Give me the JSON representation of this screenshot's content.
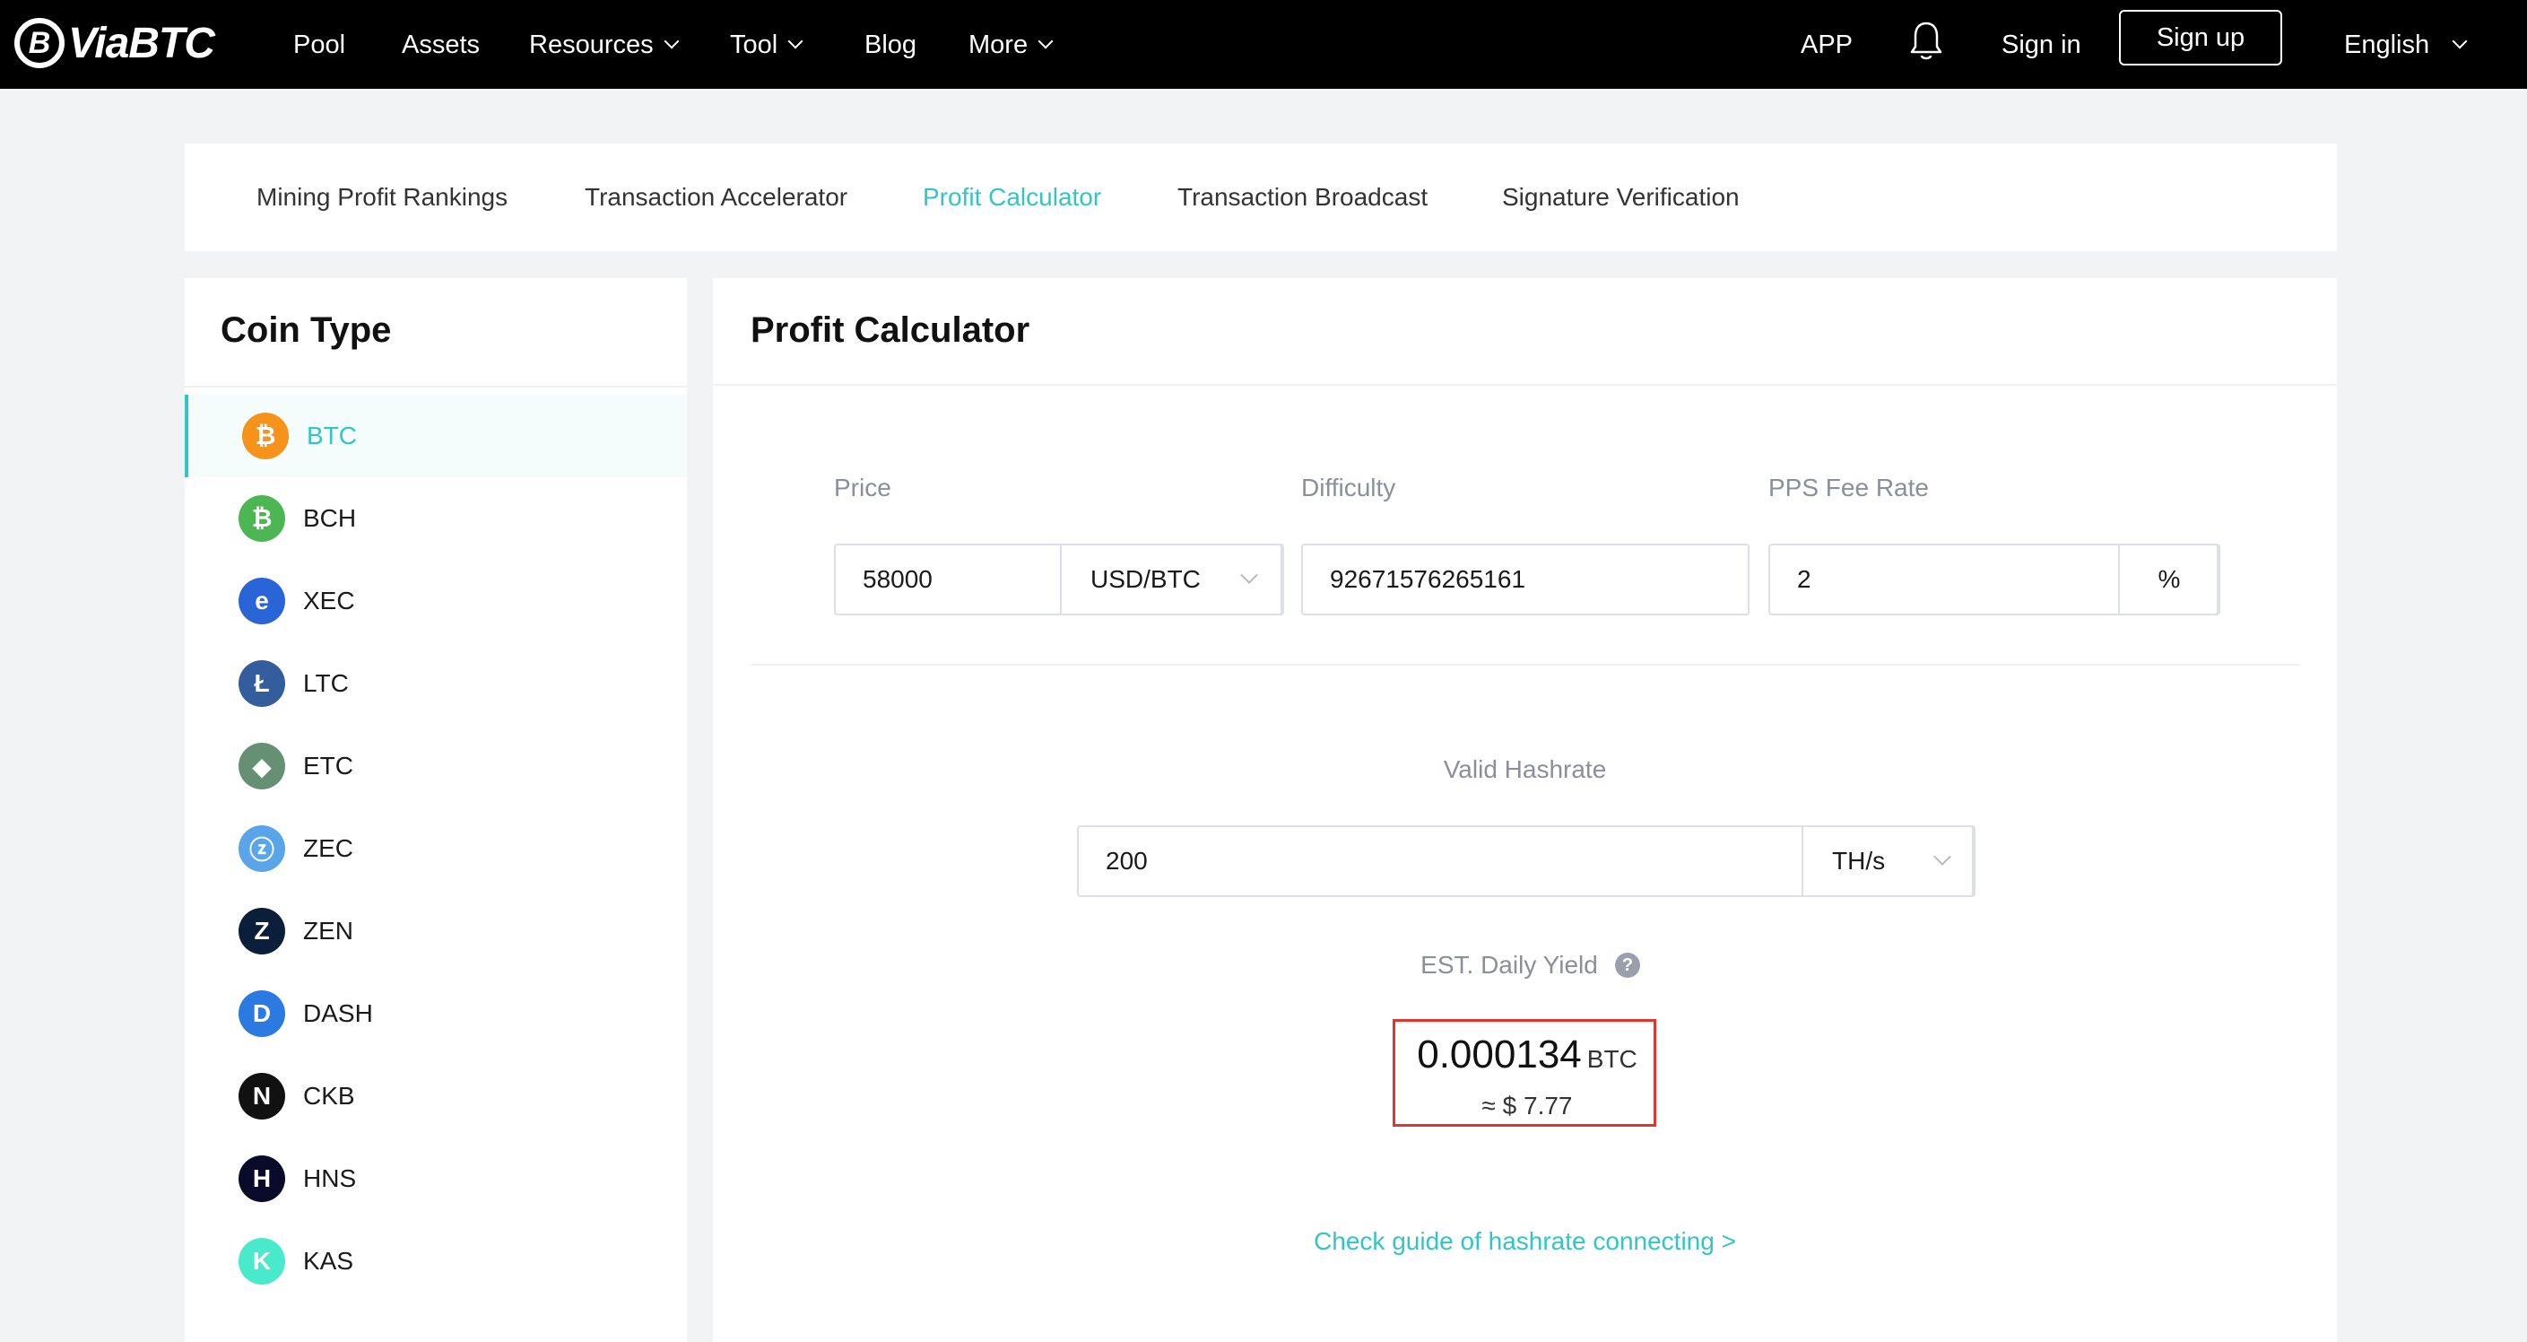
{
  "brand": {
    "name": "ViaBTC",
    "logo_mark": "B"
  },
  "nav": {
    "items": [
      {
        "label": "Pool",
        "has_dropdown": false
      },
      {
        "label": "Assets",
        "has_dropdown": false
      },
      {
        "label": "Resources",
        "has_dropdown": true
      },
      {
        "label": "Tool",
        "has_dropdown": true
      },
      {
        "label": "Blog",
        "has_dropdown": false
      },
      {
        "label": "More",
        "has_dropdown": true
      }
    ],
    "app_label": "APP",
    "bell_icon": "bell-icon",
    "signin_label": "Sign in",
    "signup_label": "Sign up",
    "language_label": "English"
  },
  "tool_tabs": [
    {
      "label": "Mining Profit Rankings",
      "active": false
    },
    {
      "label": "Transaction Accelerator",
      "active": false
    },
    {
      "label": "Profit Calculator",
      "active": true
    },
    {
      "label": "Transaction Broadcast",
      "active": false
    },
    {
      "label": "Signature Verification",
      "active": false
    }
  ],
  "sidebar": {
    "title": "Coin Type",
    "coins": [
      {
        "name": "BTC",
        "icon": "btc-icon",
        "glyph": "₿",
        "color": "#f7931a",
        "active": true
      },
      {
        "name": "BCH",
        "icon": "bch-icon",
        "glyph": "₿",
        "color": "#4cb652",
        "active": false
      },
      {
        "name": "XEC",
        "icon": "xec-icon",
        "glyph": "e",
        "color": "#2a65d8",
        "active": false
      },
      {
        "name": "LTC",
        "icon": "ltc-icon",
        "glyph": "Ł",
        "color": "#345d9d",
        "active": false
      },
      {
        "name": "ETC",
        "icon": "etc-icon",
        "glyph": "◆",
        "color": "#669073",
        "active": false
      },
      {
        "name": "ZEC",
        "icon": "zec-icon",
        "glyph": "ⓩ",
        "color": "#5aa5e8",
        "active": false
      },
      {
        "name": "ZEN",
        "icon": "zen-icon",
        "glyph": "Z",
        "color": "#0b1f3a",
        "active": false
      },
      {
        "name": "DASH",
        "icon": "dash-icon",
        "glyph": "D",
        "color": "#2a7ae2",
        "active": false
      },
      {
        "name": "CKB",
        "icon": "ckb-icon",
        "glyph": "N",
        "color": "#111111",
        "active": false
      },
      {
        "name": "HNS",
        "icon": "hns-icon",
        "glyph": "H",
        "color": "#0a0a2a",
        "active": false
      },
      {
        "name": "KAS",
        "icon": "kas-icon",
        "glyph": "K",
        "color": "#49eacb",
        "active": false
      }
    ]
  },
  "calculator": {
    "title": "Profit Calculator",
    "price": {
      "label": "Price",
      "value": "58000",
      "unit": "USD/BTC"
    },
    "difficulty": {
      "label": "Difficulty",
      "value": "92671576265161"
    },
    "pps_fee": {
      "label": "PPS Fee Rate",
      "value": "2",
      "unit": "%"
    },
    "hashrate": {
      "label": "Valid Hashrate",
      "value": "200",
      "unit": "TH/s"
    },
    "yield": {
      "label": "EST. Daily Yield",
      "help_icon": "question-icon",
      "value": "0.000134",
      "unit": "BTC",
      "usd": "≈ $ 7.77"
    },
    "guide_link": "Check guide of hashrate connecting >",
    "highlight_color": "#e0362c",
    "accent_color": "#33c5c5"
  }
}
